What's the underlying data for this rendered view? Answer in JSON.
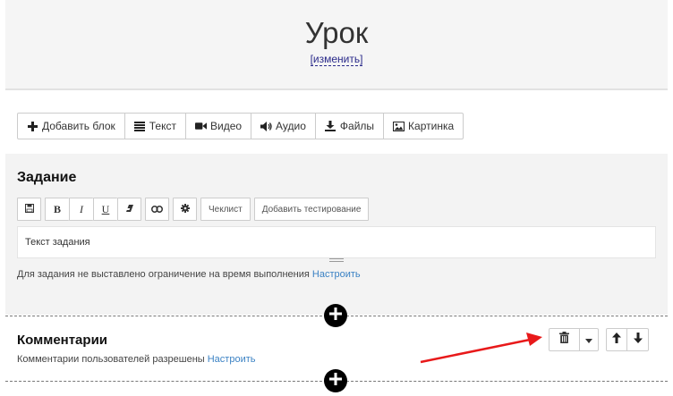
{
  "header": {
    "title": "Урок",
    "edit_link": "[изменить]"
  },
  "toolbar": {
    "items": [
      {
        "label": "Добавить блок",
        "icon": "plus-icon"
      },
      {
        "label": "Текст",
        "icon": "text-lines-icon"
      },
      {
        "label": "Видео",
        "icon": "video-camera-icon"
      },
      {
        "label": "Аудио",
        "icon": "speaker-icon"
      },
      {
        "label": "Файлы",
        "icon": "download-icon"
      },
      {
        "label": "Картинка",
        "icon": "image-icon"
      }
    ]
  },
  "task": {
    "title": "Задание",
    "editor": {
      "save_icon": "save-icon",
      "bold_label": "B",
      "italic_label": "I",
      "underline_label": "U",
      "eraser_icon": "eraser-icon",
      "link_icon": "link-icon",
      "settings_icon": "gear-icon",
      "checklist_label": "Чеклист",
      "add_test_label": "Добавить тестирование"
    },
    "textarea_value": "Текст задания",
    "time_limit_note": "Для задания не выставлено ограничение на время выполнения",
    "time_limit_link": "Настроить"
  },
  "comments": {
    "title": "Комментарии",
    "note": "Комментарии пользователей разрешены",
    "link": "Настроить",
    "controls": {
      "delete_icon": "trash-icon",
      "dropdown_icon": "caret-down-icon",
      "move_up_icon": "arrow-up-icon",
      "move_down_icon": "arrow-down-icon"
    }
  },
  "colors": {
    "link": "#3b82c4",
    "annotation_arrow": "#e8191a",
    "plus_button": "#000000",
    "panel_background": "#f3f3f3"
  }
}
